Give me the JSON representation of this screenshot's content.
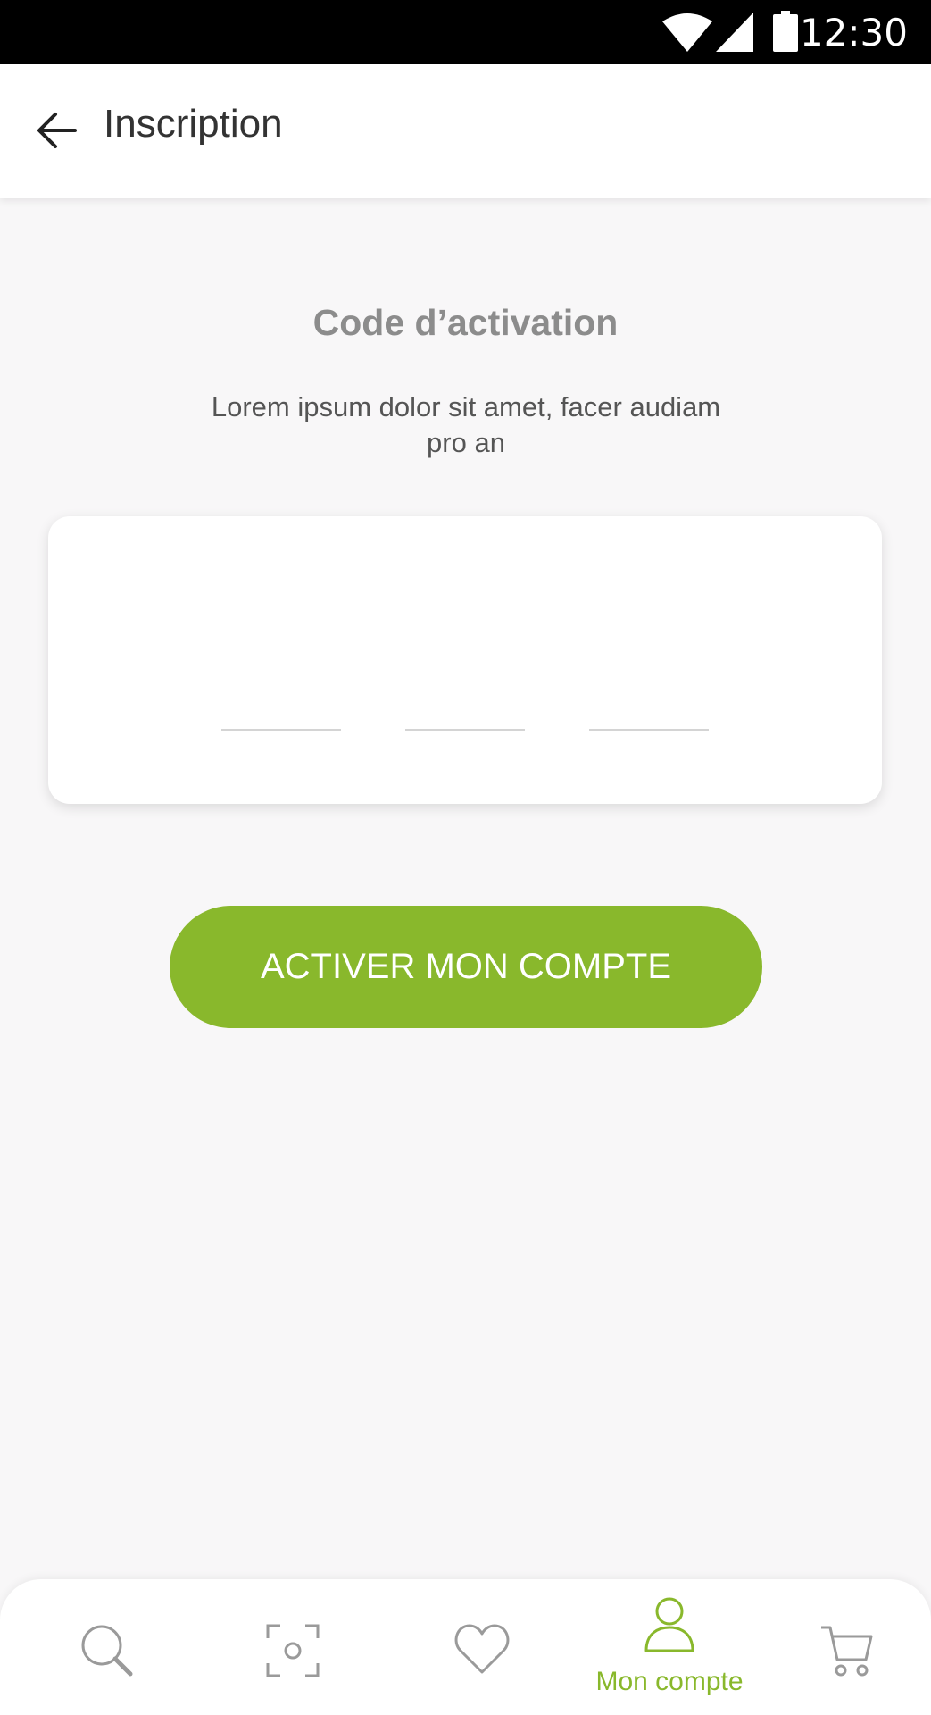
{
  "status_bar": {
    "time": "12:30"
  },
  "app_bar": {
    "title": "Inscription"
  },
  "activation": {
    "title": "Code d’activation",
    "description": "Lorem ipsum dolor sit amet, facer audiam pro an",
    "code_fields": [
      "",
      "",
      ""
    ]
  },
  "actions": {
    "activate_label": "ACTIVER MON COMPTE"
  },
  "bottom_nav": {
    "items": [
      {
        "icon": "search-icon",
        "label": ""
      },
      {
        "icon": "scan-icon",
        "label": ""
      },
      {
        "icon": "heart-icon",
        "label": ""
      },
      {
        "icon": "user-icon",
        "label": "Mon compte",
        "active": true
      },
      {
        "icon": "cart-icon",
        "label": ""
      }
    ]
  },
  "colors": {
    "accent": "#89b82c",
    "background": "#f8f7f8",
    "icon_inactive": "#9a9a9a"
  }
}
